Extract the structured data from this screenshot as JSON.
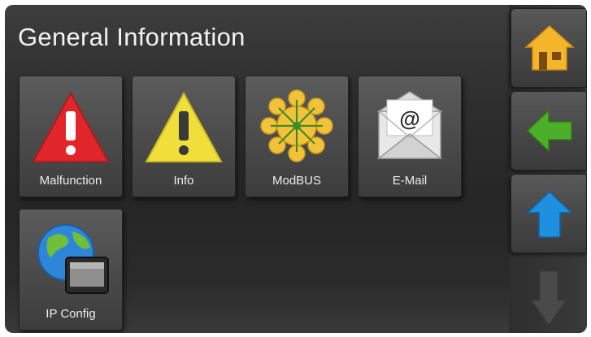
{
  "screen": {
    "title": "General Information"
  },
  "tiles": [
    {
      "label": "Malfunction",
      "icon": "warning-red-icon"
    },
    {
      "label": "Info",
      "icon": "warning-yellow-icon"
    },
    {
      "label": "ModBUS",
      "icon": "network-hub-icon"
    },
    {
      "label": "E-Mail",
      "icon": "envelope-at-icon"
    },
    {
      "label": "IP Config",
      "icon": "globe-device-icon"
    }
  ],
  "side_nav": {
    "home": {
      "icon": "home-icon"
    },
    "back": {
      "icon": "arrow-left-icon"
    },
    "up": {
      "icon": "arrow-up-icon"
    },
    "down": {
      "icon": "arrow-down-icon"
    }
  },
  "colors": {
    "home": "#f5b52a",
    "back": "#4caf2a",
    "up": "#1f8fe0",
    "down_disabled": "#4a4a4a",
    "malfunction": "#e0262b",
    "info": "#f0df3a"
  }
}
